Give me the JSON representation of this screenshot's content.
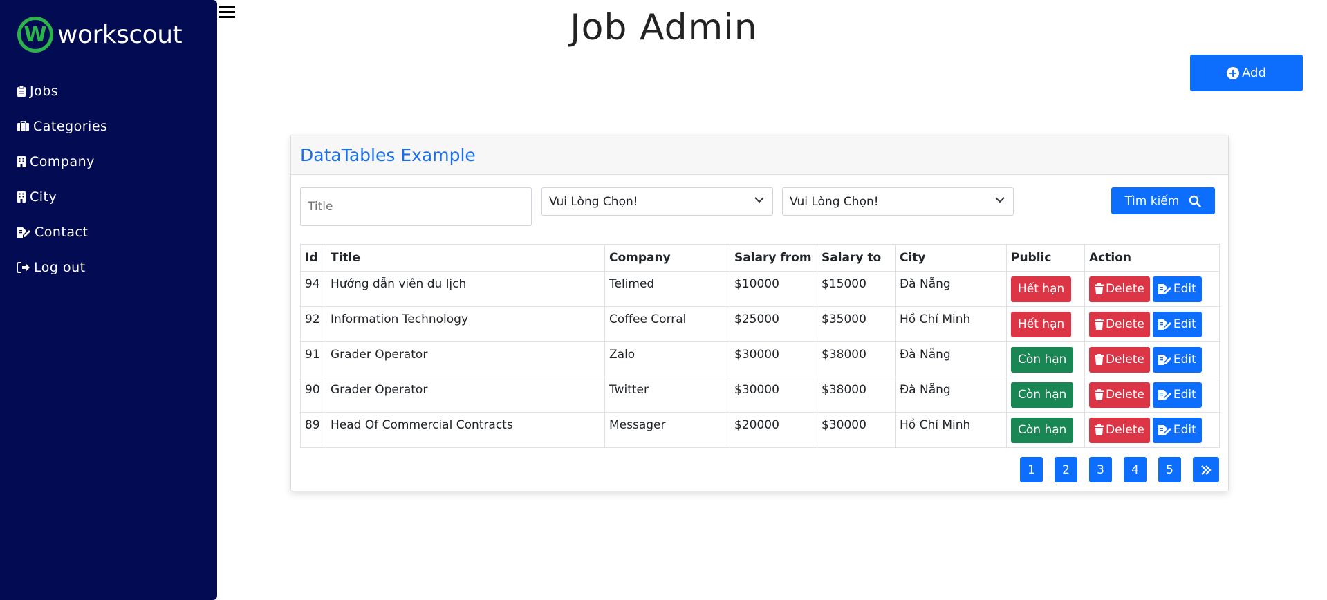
{
  "brand": {
    "name": "workscout",
    "mark": "W",
    "accent": "#2bb44a",
    "sidebar_bg": "#030c52"
  },
  "sidebar": {
    "items": [
      {
        "label": "Jobs",
        "icon": "clipboard-icon"
      },
      {
        "label": "Categories",
        "icon": "briefcase-icon"
      },
      {
        "label": "Company",
        "icon": "building-icon"
      },
      {
        "label": "City",
        "icon": "building-icon"
      },
      {
        "label": "Contact",
        "icon": "edit-icon"
      },
      {
        "label": "Log out",
        "icon": "logout-icon"
      }
    ]
  },
  "header": {
    "title": "Job Admin",
    "add_label": "Add"
  },
  "card": {
    "title": "DataTables Example"
  },
  "filters": {
    "title_placeholder": "Title",
    "select1": "Vui Lòng Chọn!",
    "select2": "Vui Lòng Chọn!",
    "search_label": "Tìm kiếm"
  },
  "table": {
    "headers": [
      "Id",
      "Title",
      "Company",
      "Salary from",
      "Salary to",
      "City",
      "Public",
      "Action"
    ],
    "rows": [
      {
        "id": "94",
        "title": "Hướng dẫn viên du lịch",
        "company": "Telimed",
        "salary_from": "$10000",
        "salary_to": "$15000",
        "city": "Đà Nẵng",
        "public": "Hết hạn",
        "status": "expired"
      },
      {
        "id": "92",
        "title": "Information Technology",
        "company": "Coffee Corral",
        "salary_from": "$25000",
        "salary_to": "$35000",
        "city": "Hồ Chí Minh",
        "public": "Hết hạn",
        "status": "expired"
      },
      {
        "id": "91",
        "title": "Grader Operator",
        "company": "Zalo",
        "salary_from": "$30000",
        "salary_to": "$38000",
        "city": "Đà Nẵng",
        "public": "Còn hạn",
        "status": "active"
      },
      {
        "id": "90",
        "title": "Grader Operator",
        "company": "Twitter",
        "salary_from": "$30000",
        "salary_to": "$38000",
        "city": "Đà Nẵng",
        "public": "Còn hạn",
        "status": "active"
      },
      {
        "id": "89",
        "title": "Head Of Commercial Contracts",
        "company": "Messager",
        "salary_from": "$20000",
        "salary_to": "$30000",
        "city": "Hồ Chí Minh",
        "public": "Còn hạn",
        "status": "active"
      }
    ],
    "delete_label": "Delete",
    "edit_label": "Edit"
  },
  "pagination": {
    "pages": [
      "1",
      "2",
      "3",
      "4",
      "5"
    ],
    "next_icon": "double-chevron-right-icon"
  }
}
